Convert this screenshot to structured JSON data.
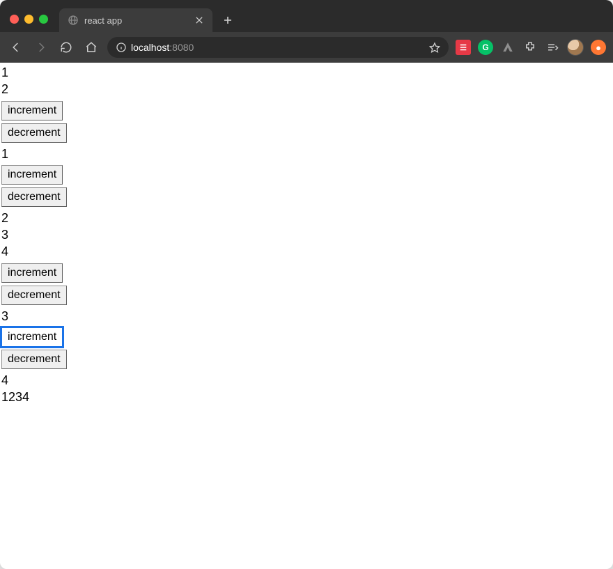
{
  "tab": {
    "title": "react app"
  },
  "url": {
    "host": "localhost",
    "port": ":8080"
  },
  "app": {
    "rows": [
      {
        "kind": "text",
        "value": "1"
      },
      {
        "kind": "text",
        "value": "2"
      },
      {
        "kind": "button",
        "value": "increment",
        "focused": false
      },
      {
        "kind": "button",
        "value": "decrement",
        "focused": false
      },
      {
        "kind": "text",
        "value": "1"
      },
      {
        "kind": "button",
        "value": "increment",
        "focused": false
      },
      {
        "kind": "button",
        "value": "decrement",
        "focused": false
      },
      {
        "kind": "text",
        "value": "2"
      },
      {
        "kind": "text",
        "value": "3"
      },
      {
        "kind": "text",
        "value": "4"
      },
      {
        "kind": "button",
        "value": "increment",
        "focused": false
      },
      {
        "kind": "button",
        "value": "decrement",
        "focused": false
      },
      {
        "kind": "text",
        "value": "3"
      },
      {
        "kind": "button",
        "value": "increment",
        "focused": true
      },
      {
        "kind": "button",
        "value": "decrement",
        "focused": false
      },
      {
        "kind": "text",
        "value": "4"
      },
      {
        "kind": "text",
        "value": "1234"
      }
    ]
  }
}
